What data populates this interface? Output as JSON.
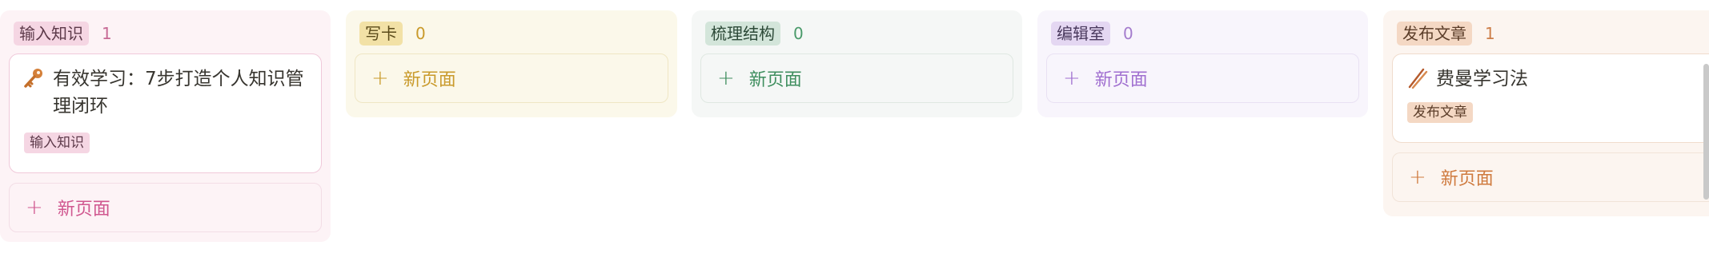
{
  "columns": [
    {
      "id": "input",
      "label": "输入知识",
      "count": "1",
      "cards": [
        {
          "title": "有效学习：7步打造个人知识管理闭环",
          "icon": "key-icon",
          "tag": "输入知识"
        }
      ],
      "new_page_label": "新页面"
    },
    {
      "id": "write",
      "label": "写卡",
      "count": "0",
      "cards": [],
      "new_page_label": "新页面"
    },
    {
      "id": "structure",
      "label": "梳理结构",
      "count": "0",
      "cards": [],
      "new_page_label": "新页面"
    },
    {
      "id": "editor",
      "label": "编辑室",
      "count": "0",
      "cards": [],
      "new_page_label": "新页面"
    },
    {
      "id": "publish",
      "label": "发布文章",
      "count": "1",
      "cards": [
        {
          "title": "费曼学习法",
          "icon": "chopsticks-icon",
          "tag": "发布文章"
        }
      ],
      "new_page_label": "新页面"
    }
  ],
  "colors": {
    "pink": "#d0578f",
    "yellow": "#c99a2b",
    "green": "#3e8e5e",
    "purple": "#a06fd0",
    "orange": "#cf7a3e"
  }
}
